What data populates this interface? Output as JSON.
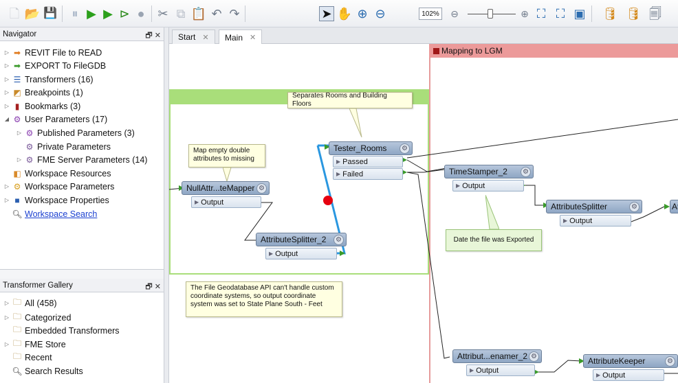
{
  "toolbar": {
    "zoom": "102%",
    "icons": [
      "new-icon",
      "open-icon",
      "save-icon",
      "pause-icon",
      "run-icon",
      "run-to-icon",
      "step-icon",
      "stop-icon",
      "cut-icon",
      "copy-icon",
      "paste-icon",
      "undo-icon",
      "redo-icon",
      "select-icon",
      "pan-icon",
      "zoom-in-icon",
      "zoom-out-icon",
      "zoom-minus-icon",
      "zoom-plus-icon",
      "zoom-selection-icon",
      "zoom-extents-icon",
      "zoom-fit-icon",
      "add-reader-icon",
      "add-writer-icon",
      "add-transformer-icon"
    ]
  },
  "navigator": {
    "title": "Navigator",
    "items": [
      {
        "label": "REVIT File to READ"
      },
      {
        "label": "EXPORT To FileGDB"
      },
      {
        "label": "Transformers (16)"
      },
      {
        "label": "Breakpoints (1)"
      },
      {
        "label": "Bookmarks (3)"
      },
      {
        "label": "User Parameters (17)"
      },
      {
        "label": "Published Parameters (3)"
      },
      {
        "label": "Private Parameters"
      },
      {
        "label": "FME Server Parameters (14)"
      },
      {
        "label": "Workspace Resources"
      },
      {
        "label": "Workspace Parameters"
      },
      {
        "label": "Workspace Properties"
      },
      {
        "label": "Workspace Search"
      }
    ]
  },
  "gallery": {
    "title": "Transformer Gallery",
    "items": [
      {
        "label": "All (458)"
      },
      {
        "label": "Categorized"
      },
      {
        "label": "Embedded Transformers"
      },
      {
        "label": "FME Store"
      },
      {
        "label": "Recent"
      },
      {
        "label": "Search Results"
      }
    ]
  },
  "tabs": [
    {
      "label": "Start"
    },
    {
      "label": "Main"
    }
  ],
  "canvas": {
    "bookmark_red": "Mapping to LGM",
    "annotations": {
      "separates": "Separates Rooms and Building Floors",
      "map_empty": "Map empty double attributes to missing",
      "date": "Date the file was Exported",
      "filegdb": "The File Geodatabase API can't handle custom coordinate systems, so output coordinate system was set to State Plane South - Feet"
    },
    "nodes": {
      "nullattr": {
        "name": "NullAttr...teMapper",
        "ports": [
          "Output"
        ]
      },
      "tester": {
        "name": "Tester_Rooms",
        "ports": [
          "Passed",
          "Failed"
        ]
      },
      "splitter2": {
        "name": "AttributeSplitter_2",
        "ports": [
          "Output"
        ]
      },
      "timestamper": {
        "name": "TimeStamper_2",
        "ports": [
          "Output"
        ]
      },
      "splitter": {
        "name": "AttributeSplitter",
        "ports": [
          "Output"
        ]
      },
      "partial": {
        "name": "At"
      },
      "renamer": {
        "name": "Attribut...enamer_2",
        "ports": [
          "Output"
        ]
      },
      "keeper": {
        "name": "AttributeKeeper",
        "ports": [
          "Output"
        ]
      }
    }
  }
}
